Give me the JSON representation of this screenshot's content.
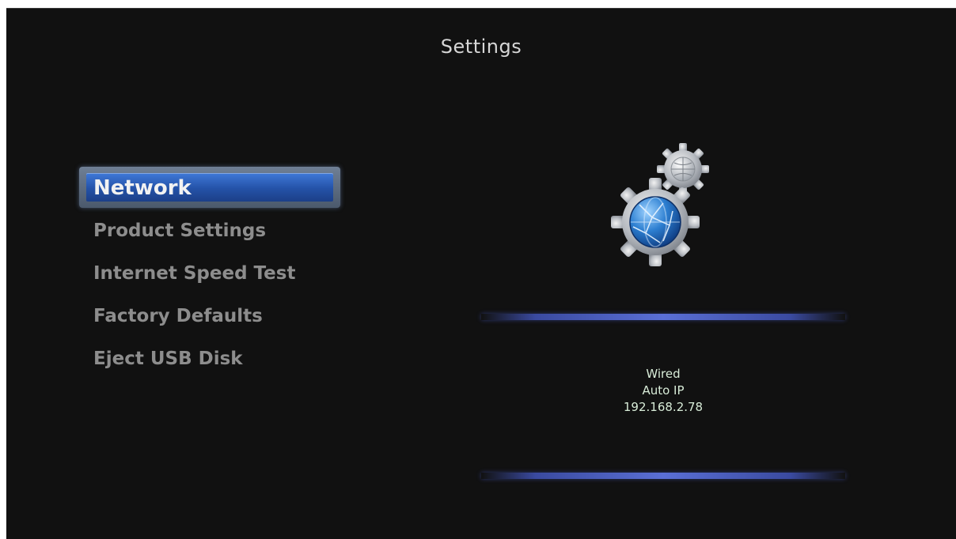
{
  "header": {
    "title": "Settings"
  },
  "menu": {
    "selected_index": 0,
    "items": [
      {
        "label": "Network"
      },
      {
        "label": "Product Settings"
      },
      {
        "label": "Internet Speed Test"
      },
      {
        "label": "Factory Defaults"
      },
      {
        "label": "Eject USB Disk"
      }
    ]
  },
  "detail": {
    "icon": "network-gears-icon",
    "connection_type": "Wired",
    "ip_mode": "Auto IP",
    "ip_address": "192.168.2.78"
  },
  "colors": {
    "background": "#111111",
    "highlight": "#2452a7",
    "divider": "#5a6fd6",
    "info_text": "#d8ecd8"
  }
}
